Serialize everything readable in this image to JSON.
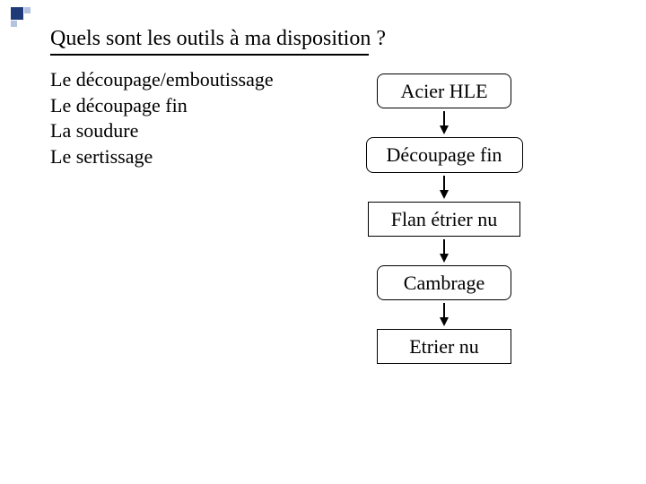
{
  "title": "Quels sont les outils à ma disposition ?",
  "tools": [
    "Le découpage/emboutissage",
    "Le découpage fin",
    "La soudure",
    "Le sertissage"
  ],
  "flow": {
    "nodes": [
      {
        "label": "Acier HLE",
        "shape": "rounded"
      },
      {
        "label": "Découpage fin",
        "shape": "rounded"
      },
      {
        "label": "Flan étrier nu",
        "shape": "rect"
      },
      {
        "label": "Cambrage",
        "shape": "rounded"
      },
      {
        "label": "Etrier nu",
        "shape": "rect"
      }
    ]
  },
  "colors": {
    "accent_dark": "#1f3a78",
    "accent_light": "#b4c3e0"
  }
}
